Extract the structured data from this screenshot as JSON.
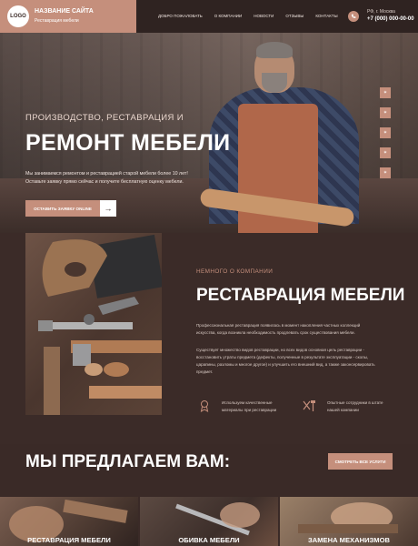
{
  "header": {
    "logo": "LOGO",
    "site_name": "НАЗВАНИЕ САЙТА",
    "site_subtitle": "Реставрация мебели",
    "nav": [
      "Добро пожаловать",
      "О компании",
      "Новости",
      "Отзывы",
      "Контакты"
    ],
    "city": "РФ, г. Москва",
    "phone": "+7 (000) 000-00-00"
  },
  "hero": {
    "tagline": "ПРОИЗВОДСТВО, РЕСТАВРАЦИЯ И",
    "title": "РЕМОНТ МЕБЕЛИ",
    "text": "Мы занимаемся ремонтом и реставрацией старой мебели более 10 лет! Оставьте заявку прямо сейчас и получите бесплатную оценку мебели.",
    "button": "Оставить заявку online",
    "arrow": "→",
    "social": [
      "vk",
      "tw",
      "fb",
      "ok",
      "tg"
    ]
  },
  "about": {
    "eyebrow": "НЕМНОГО О КОМПАНИИ",
    "title": "РЕСТАВРАЦИЯ МЕБЕЛИ",
    "p1": "Профессиональная реставрация появилась в момент накопления частных коллекций искусства, когда возникла необходимость продлевать срок существования мебели.",
    "p2": "Существует множество видов реставрации, но всех видов основная цель реставрации - восстановить утраты предмета (дефекты, полученные в результате эксплуатации - сколы, царапины, разломы и многое другое) и улучшить его внешний вид, а также законсервировать предмет.",
    "features": [
      {
        "icon": "award-icon",
        "text": "Используем качественные материалы при реставрации"
      },
      {
        "icon": "tools-icon",
        "text": "Опытные сотрудники в штате нашей компании"
      }
    ]
  },
  "offer": {
    "title": "МЫ ПРЕДЛАГАЕМ ВАМ:",
    "button": "Смотреть все услуги"
  },
  "services": [
    {
      "label": "РЕСТАВРАЦИЯ МЕБЕЛИ"
    },
    {
      "label": "ОБИВКА МЕБЕЛИ"
    },
    {
      "label": "ЗАМЕНА МЕХАНИЗМОВ"
    }
  ],
  "colors": {
    "accent": "#c58f7c",
    "dark": "#3b2b28",
    "header": "#2f2321"
  }
}
